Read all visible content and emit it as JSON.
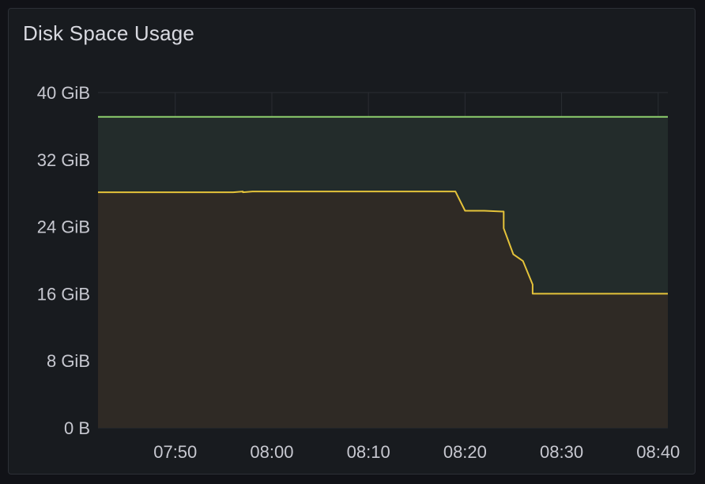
{
  "panel": {
    "title": "Disk Space Usage"
  },
  "colors": {
    "total_line": "#8ecf6d",
    "used_line": "#e5c33a",
    "total_fill": "#232c2b",
    "used_fill": "#2f2a25",
    "grid": "#2a2d33"
  },
  "chart_data": {
    "type": "area",
    "title": "Disk Space Usage",
    "xlabel": "",
    "ylabel": "",
    "y_unit": "GiB",
    "ylim": [
      0,
      40
    ],
    "xlim": [
      "07:42",
      "08:41"
    ],
    "grid": true,
    "legend": "none",
    "yticks": [
      {
        "value": 0,
        "label": "0 B"
      },
      {
        "value": 8,
        "label": "8 GiB"
      },
      {
        "value": 16,
        "label": "16 GiB"
      },
      {
        "value": 24,
        "label": "24 GiB"
      },
      {
        "value": 32,
        "label": "32 GiB"
      },
      {
        "value": 40,
        "label": "40 GiB"
      }
    ],
    "xticks": [
      {
        "value": "07:50",
        "label": "07:50"
      },
      {
        "value": "08:00",
        "label": "08:00"
      },
      {
        "value": "08:10",
        "label": "08:10"
      },
      {
        "value": "08:20",
        "label": "08:20"
      },
      {
        "value": "08:30",
        "label": "08:30"
      },
      {
        "value": "08:40",
        "label": "08:40"
      }
    ],
    "series": [
      {
        "color": "#8ecf6d",
        "x": [
          "07:42",
          "08:41"
        ],
        "values": [
          37.1,
          37.1
        ]
      },
      {
        "color": "#e5c33a",
        "x": [
          "07:42",
          "07:56",
          "07:57",
          "07:57",
          "07:58",
          "08:00",
          "08:10",
          "08:19",
          "08:20",
          "08:22",
          "08:24",
          "08:24",
          "08:25",
          "08:26",
          "08:26",
          "08:27",
          "08:27",
          "08:30",
          "08:41"
        ],
        "values": [
          28.1,
          28.1,
          28.2,
          28.1,
          28.2,
          28.2,
          28.2,
          28.2,
          25.9,
          25.9,
          25.8,
          23.8,
          20.7,
          19.9,
          19.9,
          17.1,
          16.0,
          16.0,
          16.0
        ]
      }
    ]
  }
}
